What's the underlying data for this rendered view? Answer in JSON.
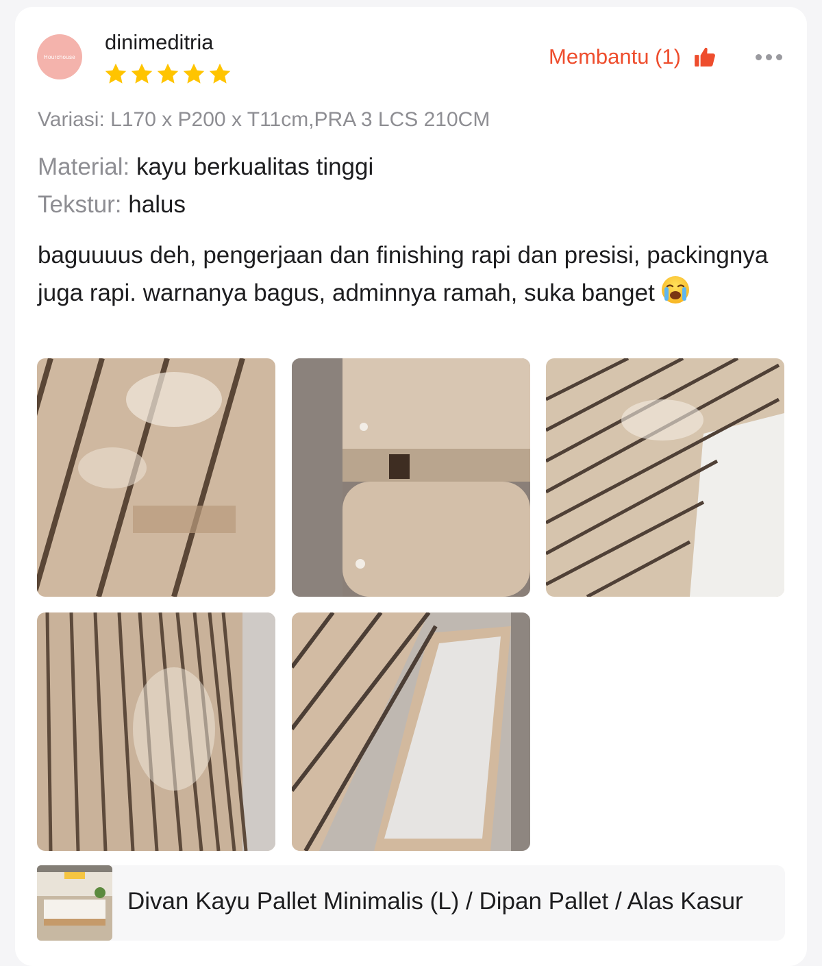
{
  "review": {
    "avatar_text": "Hourchouse",
    "username": "dinimeditria",
    "rating": 5,
    "helpful_label": "Membantu (1)",
    "variation": "Variasi: L170 x P200 x T11cm,PRA 3 LCS 210CM",
    "attributes": [
      {
        "key": "Material:",
        "value": "kayu berkualitas tinggi"
      },
      {
        "key": "Tekstur:",
        "value": "halus"
      }
    ],
    "text": "baguuuus deh, pengerjaan dan finishing rapi dan presisi, packingnya juga rapi. warnanya bagus, adminnya ramah, suka banget"
  },
  "photos": [
    {
      "subject": "wooden bed slats close-up"
    },
    {
      "subject": "wooden frame corner joint"
    },
    {
      "subject": "slats over storage drawer"
    },
    {
      "subject": "parallel wooden slats"
    },
    {
      "subject": "slats beside drawer compartment"
    }
  ],
  "product": {
    "name": "Divan Kayu Pallet Minimalis (L) / Dipan Pallet / Alas Kasur"
  },
  "colors": {
    "accent": "#ee4d2d",
    "star": "#ffc400",
    "muted_text": "#8e8e93",
    "text": "#1d1d1f"
  },
  "icons": [
    "avatar",
    "star-icon",
    "thumbs-up-icon",
    "more-icon",
    "crying-face-emoji"
  ]
}
